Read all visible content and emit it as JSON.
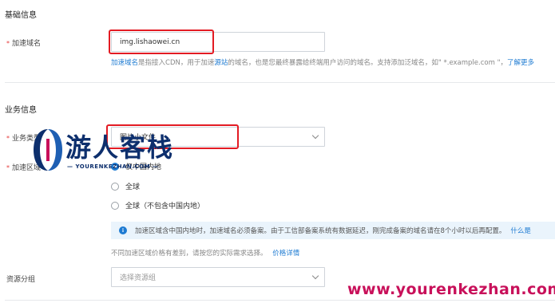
{
  "basic_section": {
    "title": "基础信息",
    "domain_label": "加速域名",
    "domain_value": "img.lishaowei.cn",
    "help_prefix": "加速域名",
    "help_mid1": "是指接入CDN，用于加速",
    "help_link2": "源站",
    "help_mid2": "的域名，也是您最终暴露给终端用户访问的域名。支持添加泛域名，如\" *.example.com \"，",
    "help_link3": "了解更多"
  },
  "business_section": {
    "title": "业务信息",
    "type_label": "业务类型",
    "type_value": "图片小文件",
    "region_label": "加速区域",
    "region_options": [
      {
        "label": "仅中国内地",
        "checked": true
      },
      {
        "label": "全球",
        "checked": false
      },
      {
        "label": "全球（不包含中国内地）",
        "checked": false
      }
    ],
    "info_text": "加速区域含中国内地时，加速域名必须备案。由于工信部备案系统有数据延迟，刚完成备案的域名请在8个小时以后再配置。",
    "info_link": "什么是",
    "price_note": "不同加速区域价格有差别，请按您的实际需求选择。",
    "price_link": "价格详情",
    "group_label": "资源分组",
    "group_placeholder": "选择资源组"
  },
  "watermark": {
    "cn_text": "游人客栈",
    "sub_text": "YOURENKEZHAN.COM",
    "url_text": "www.yourenkezhan.com"
  },
  "colors": {
    "accent": "#1e7bd2",
    "annotation_red": "#e31b23",
    "watermark_blue": "#0d2f6d",
    "watermark_magenta": "#c8105a"
  }
}
